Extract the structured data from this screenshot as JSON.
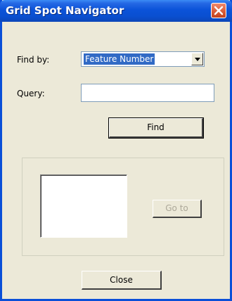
{
  "window": {
    "title": "Grid Spot Navigator"
  },
  "titlebar": {
    "close_icon": "close-icon"
  },
  "form": {
    "find_by_label": "Find by:",
    "find_by_value": "Feature Number",
    "query_label": "Query:",
    "query_value": "",
    "find_button": "Find"
  },
  "results": {
    "items": [],
    "goto_button": "Go to"
  },
  "footer": {
    "close_button": "Close"
  },
  "colors": {
    "titlebar": "#0a4fd8",
    "window_bg": "#ece9d8",
    "selection": "#316ac5",
    "close_button": "#d95a35"
  }
}
